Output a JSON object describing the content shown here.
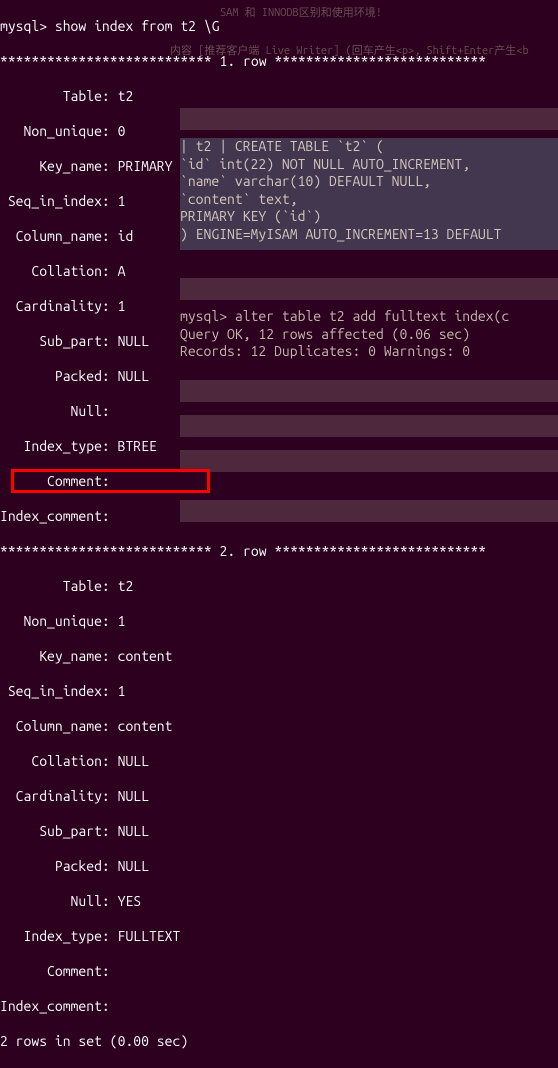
{
  "prompt": "mysql> show index from t2 \\G",
  "row1_sep": "*************************** 1. row ***************************",
  "row2_sep": "*************************** 2. row ***************************",
  "row1": {
    "Table": "        Table: t2",
    "Non_unique": "   Non_unique: 0",
    "Key_name": "     Key_name: PRIMARY",
    "Seq_in_index": " Seq_in_index: 1",
    "Column_name": "  Column_name: id",
    "Collation": "    Collation: A",
    "Cardinality": "  Cardinality: 1",
    "Sub_part": "     Sub_part: NULL",
    "Packed": "       Packed: NULL",
    "Null": "         Null:",
    "Index_type": "   Index_type: BTREE",
    "Comment": "      Comment:",
    "Index_comment": "Index_comment:"
  },
  "row2": {
    "Table": "        Table: t2",
    "Non_unique": "   Non_unique: 1",
    "Key_name": "     Key_name: content",
    "Seq_in_index": " Seq_in_index: 1",
    "Column_name": "  Column_name: content",
    "Collation": "    Collation: NULL",
    "Cardinality": "  Cardinality: NULL",
    "Sub_part": "     Sub_part: NULL",
    "Packed": "       Packed: NULL",
    "Null": "         Null: YES",
    "Index_type": "   Index_type: FULLTEXT",
    "Comment": "      Comment:",
    "Index_comment": "Index_comment:"
  },
  "footer": "2 rows in set (0.00 sec)",
  "create_table": {
    "l1": "| t2    | CREATE TABLE `t2` (",
    "l2": "  `id` int(22) NOT NULL AUTO_INCREMENT,",
    "l3": "  `name` varchar(10) DEFAULT NULL,",
    "l4": "  `content` text,",
    "l5": "  PRIMARY KEY (`id`)",
    "l6": ") ENGINE=MyISAM AUTO_INCREMENT=13 DEFAULT"
  },
  "query": {
    "l1": "mysql> alter table t2 add fulltext index(c",
    "l2": "Query OK, 12 rows affected (0.06 sec)",
    "l3": "Records: 12  Duplicates: 0  Warnings: 0"
  },
  "bg_text": {
    "title_hint": "SAM 和 INNODB区别和使用环境!",
    "editor_hint": "内容 [推荐客户端 Live Writer]  (回车产生<p>, Shift+Enter产生<b"
  }
}
